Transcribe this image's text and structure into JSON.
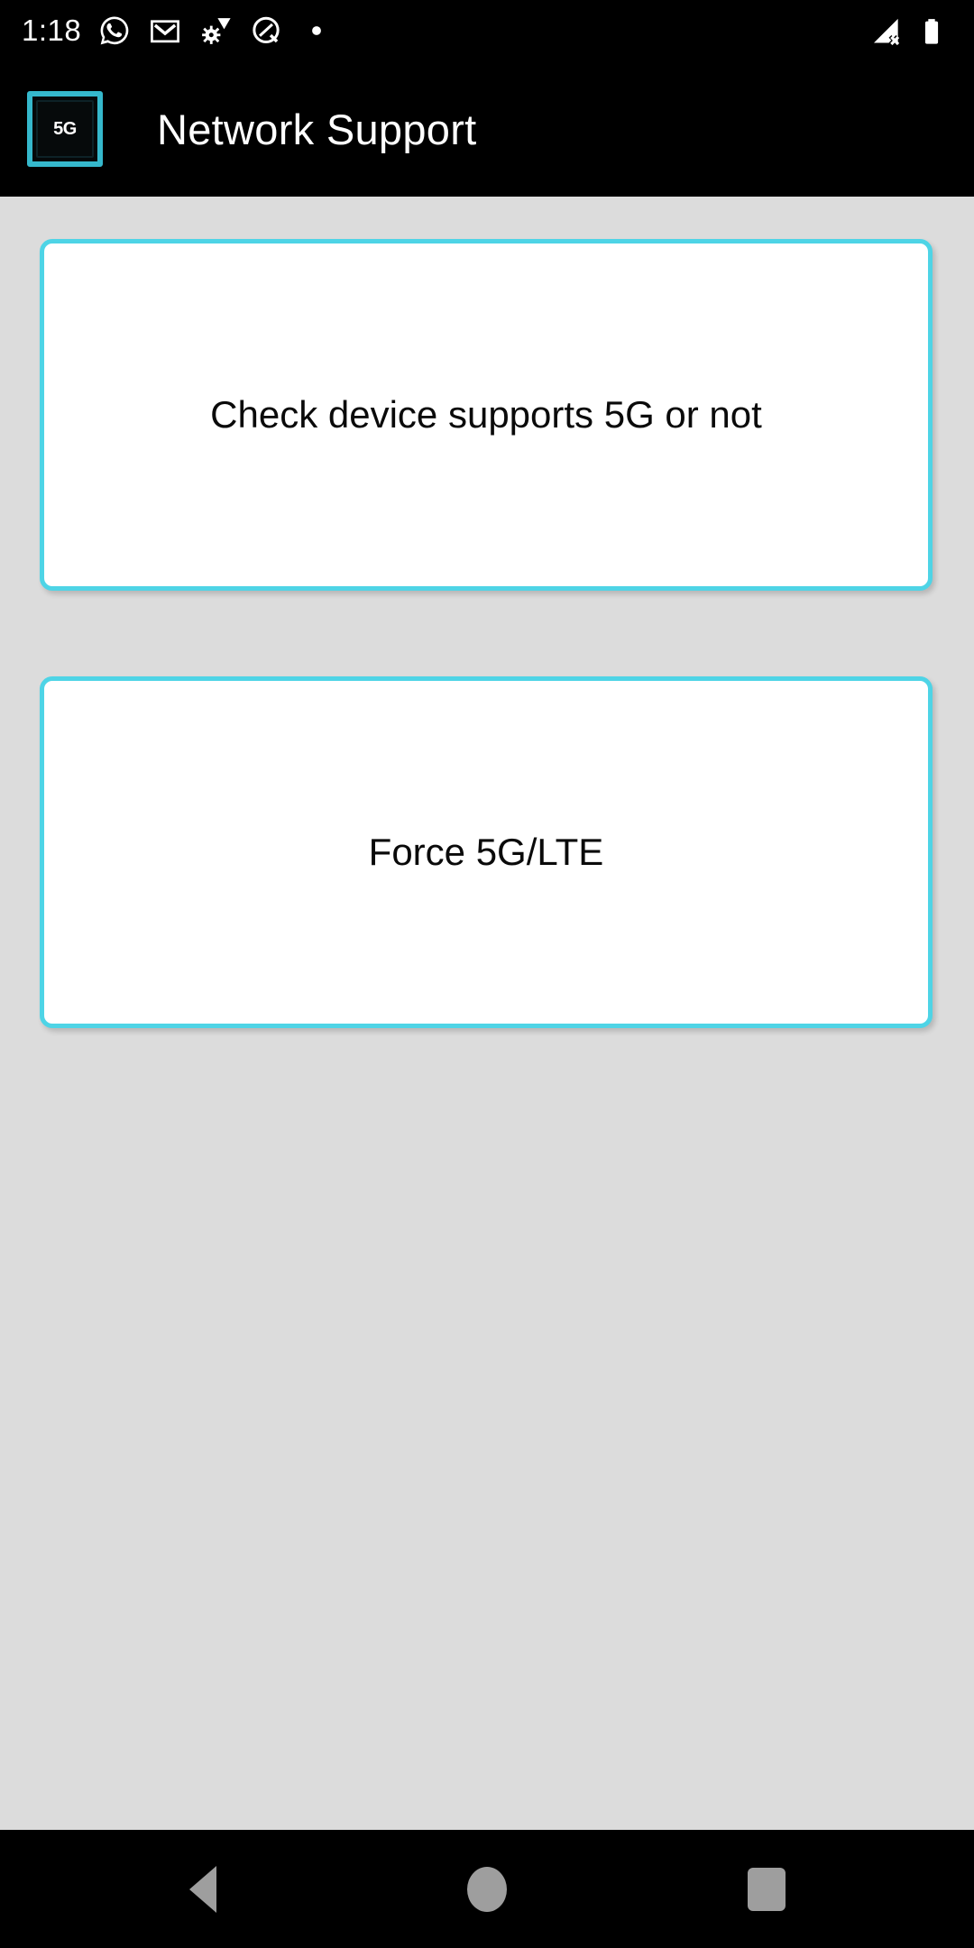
{
  "status_bar": {
    "time": "1:18",
    "left_icons": [
      {
        "name": "whatsapp-icon",
        "label": "WhatsApp"
      },
      {
        "name": "gmail-icon",
        "label": "Gmail"
      },
      {
        "name": "settings-wifi-icon",
        "label": "Settings update"
      },
      {
        "name": "android-q-icon",
        "label": "Android Q"
      },
      {
        "name": "dot-icon",
        "label": "More notifications"
      }
    ],
    "right_icons": [
      {
        "name": "signal-no-service-icon",
        "label": "No signal"
      },
      {
        "name": "battery-full-icon",
        "label": "Battery full"
      }
    ]
  },
  "app_bar": {
    "title": "Network Support",
    "icon": {
      "name": "app-logo-5g-chip-icon",
      "label": "5G"
    }
  },
  "main": {
    "cards": [
      {
        "id": "check-5g-support",
        "label": "Check device supports 5G or not"
      },
      {
        "id": "force-5g-lte",
        "label": "Force 5G/LTE"
      }
    ]
  },
  "nav_bar": {
    "back_label": "Back",
    "home_label": "Home",
    "recents_label": "Recent apps"
  },
  "colors": {
    "accent": "#4ed4e6",
    "background": "#dcdcdc",
    "bar": "#000000",
    "card": "#ffffff",
    "nav_icon": "#9e9e9e"
  }
}
